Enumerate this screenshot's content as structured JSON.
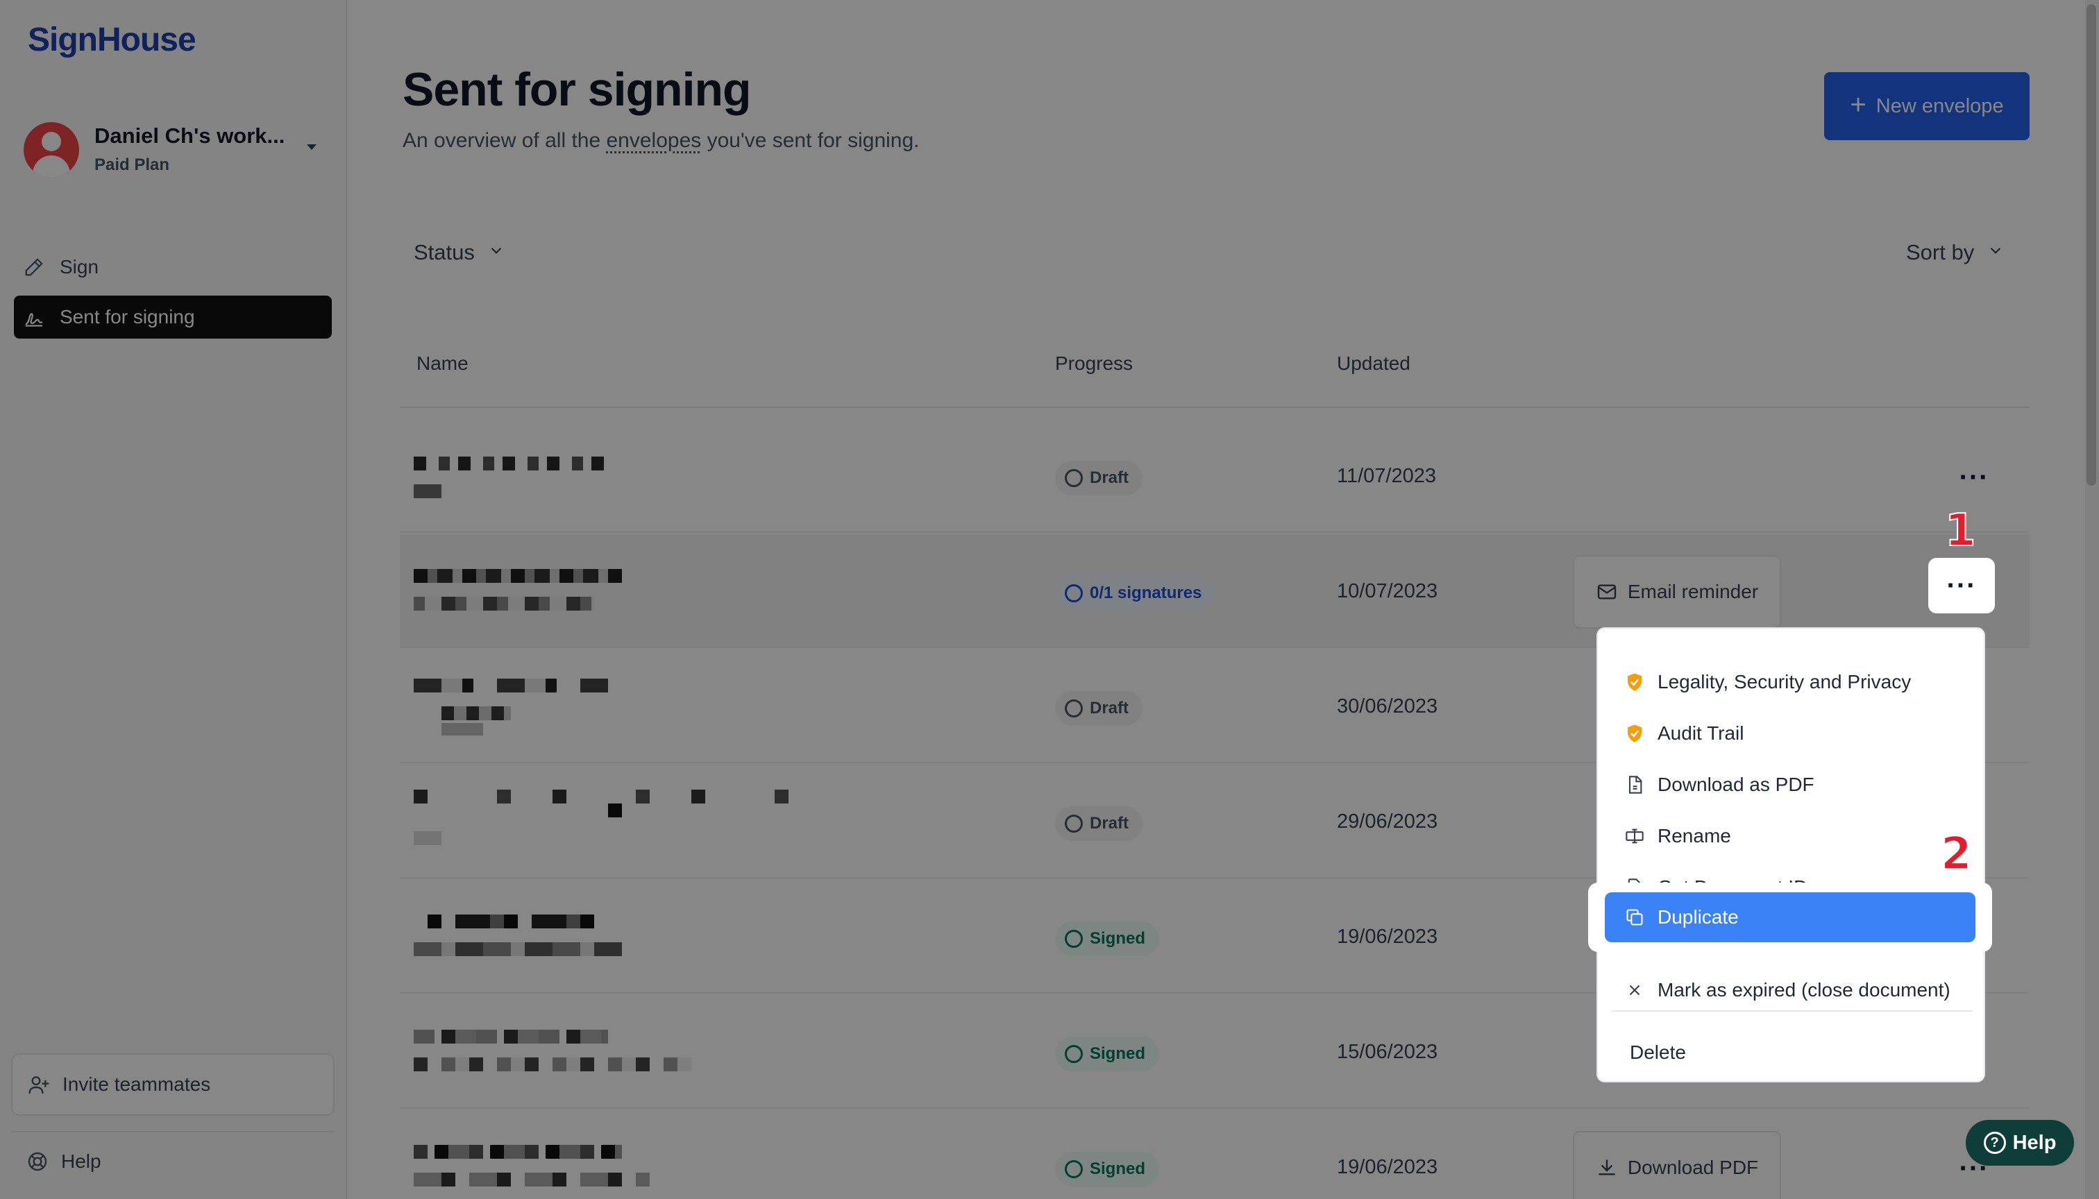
{
  "app": {
    "logo": "SignHouse"
  },
  "sidebar": {
    "workspace_name": "Daniel Ch's work...",
    "workspace_plan": "Paid Plan",
    "nav": [
      {
        "label": "Sign",
        "icon": "pen-icon"
      },
      {
        "label": "Sent for signing",
        "icon": "signature-icon",
        "active": true
      }
    ],
    "invite_label": "Invite teammates",
    "help_label": "Help"
  },
  "header": {
    "title": "Sent for signing",
    "subtitle_before": "An overview of all the ",
    "subtitle_link": "envelopes",
    "subtitle_after": " you've sent for signing.",
    "new_button": "New envelope"
  },
  "filters": {
    "status_label": "Status",
    "sort_label": "Sort by"
  },
  "table": {
    "headers": {
      "name": "Name",
      "progress": "Progress",
      "updated": "Updated"
    },
    "rows": [
      {
        "status": "Draft",
        "status_kind": "draft",
        "updated": "11/07/2023",
        "action": ""
      },
      {
        "status": "0/1 signatures",
        "status_kind": "pending",
        "updated": "10/07/2023",
        "action": "Email reminder"
      },
      {
        "status": "Draft",
        "status_kind": "draft",
        "updated": "30/06/2023",
        "action": ""
      },
      {
        "status": "Draft",
        "status_kind": "draft",
        "updated": "29/06/2023",
        "action": ""
      },
      {
        "status": "Signed",
        "status_kind": "signed",
        "updated": "19/06/2023",
        "action": ""
      },
      {
        "status": "Signed",
        "status_kind": "signed",
        "updated": "15/06/2023",
        "action": ""
      },
      {
        "status": "Signed",
        "status_kind": "signed",
        "updated": "19/06/2023",
        "action": "Download PDF"
      }
    ]
  },
  "context_menu": {
    "items": [
      {
        "label": "Legality, Security and Privacy",
        "icon": "shield-icon"
      },
      {
        "label": "Audit Trail",
        "icon": "shield-icon"
      },
      {
        "label": "Download as PDF",
        "icon": "pdf-file-icon"
      },
      {
        "label": "Rename",
        "icon": "rename-icon"
      },
      {
        "label": "Get Document ID",
        "icon": "document-search-icon"
      },
      {
        "label": "Duplicate",
        "icon": "duplicate-icon",
        "highlighted": true
      },
      {
        "label": "Mark as expired (close document)",
        "icon": "close-icon"
      }
    ],
    "delete_label": "Delete"
  },
  "annotations": {
    "step1": "1",
    "step2": "2"
  },
  "help_widget": {
    "label": "Help"
  },
  "colors": {
    "primary": "#2563eb",
    "highlight": "#3b82f6",
    "annotation": "#e11d2e",
    "draft": "#4b5563",
    "pending": "#1d4ed8",
    "signed": "#047857"
  }
}
